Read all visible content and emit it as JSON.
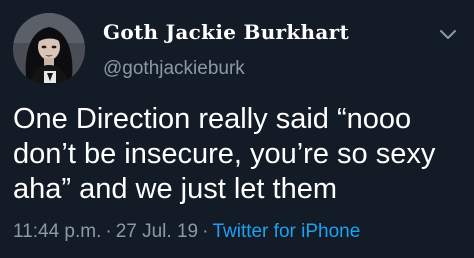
{
  "author": {
    "display_name": "Goth Jackie Burkhart",
    "handle": "@gothjackieburk"
  },
  "tweet": {
    "lines": [
      "One Direction really said “nooo",
      "don’t be insecure, you’re so sexy",
      "aha” and we just let them"
    ]
  },
  "meta": {
    "time": "11:44 p.m.",
    "separator": "·",
    "date": "27 Jul. 19",
    "source": "Twitter for iPhone"
  },
  "icons": {
    "menu": "chevron-down-icon"
  },
  "colors": {
    "background": "#131b27",
    "text": "#ffffff",
    "secondary": "#8a99a8",
    "link": "#1da1f2"
  }
}
